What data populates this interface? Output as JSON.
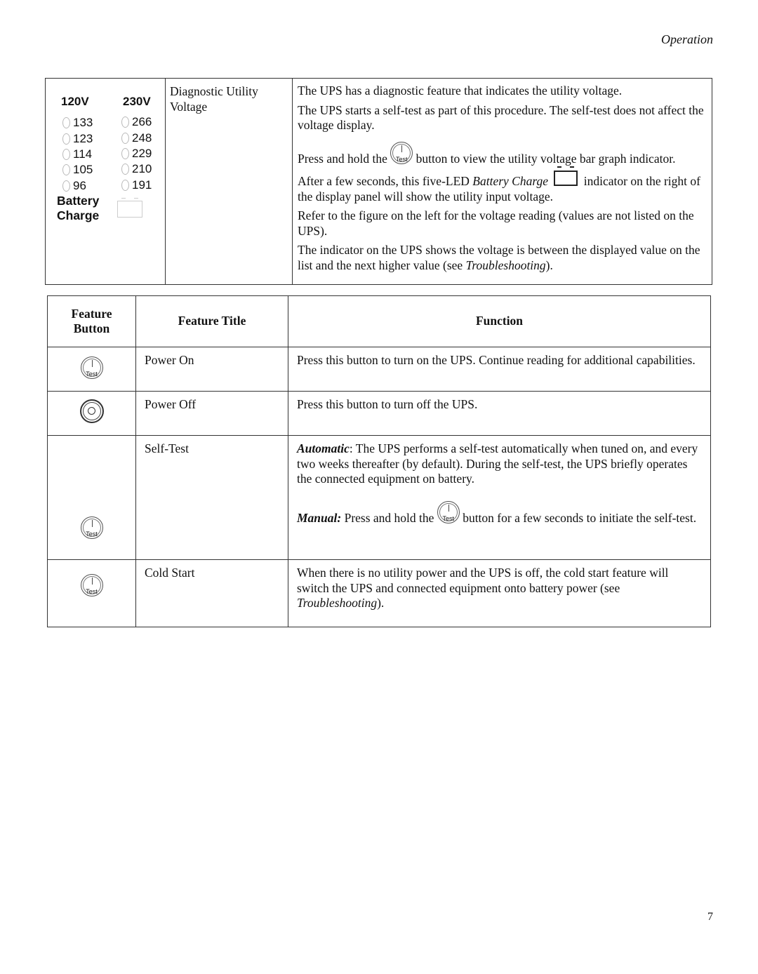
{
  "header": {
    "section": "Operation"
  },
  "page_number": "7",
  "diagnostic_table": {
    "figure": {
      "col_120_label": "120V",
      "col_230_label": "230V",
      "values_120": [
        "133",
        "123",
        "114",
        "105",
        "96"
      ],
      "values_230": [
        "266",
        "248",
        "229",
        "210",
        "191"
      ],
      "battery_label_line1": "Battery",
      "battery_label_line2": "Charge"
    },
    "title": "Diagnostic Utility Voltage",
    "paragraphs": {
      "p1": "The UPS has a diagnostic feature that indicates the utility voltage.",
      "p2": "The UPS starts a self-test as part of this procedure. The self-test does not affect the voltage display.",
      "p3_before": "Press and hold the",
      "p3_after": "button to view the utility voltage bar graph indicator.",
      "p4_before": "After a few seconds, this five-LED",
      "p4_italic": "Battery Charge",
      "p4_after": "indicator on the right of the display panel will show the utility input voltage.",
      "p5": "Refer to the figure on the left for the voltage reading (values are not listed on the UPS).",
      "p6_before": "The indicator on the UPS shows the voltage is between the displayed value on the list and the next higher value (see",
      "p6_italic": "Troubleshooting",
      "p6_after": ")."
    },
    "test_icon_label": "Test"
  },
  "feature_table": {
    "headers": {
      "button": "Feature Button",
      "title": "Feature Title",
      "function": "Function"
    },
    "rows": [
      {
        "icon": "test-button-icon",
        "title": "Power On",
        "function": "Press this button to turn on the UPS. Continue reading for additional capabilities."
      },
      {
        "icon": "power-off-button-icon",
        "title": "Power Off",
        "function": "Press this button to turn off the UPS."
      },
      {
        "icon": "test-button-icon",
        "title": "Self-Test",
        "auto_label": "Automatic",
        "auto_text": ": The UPS performs a self-test automatically when tuned on, and every two weeks thereafter (by default). During the self-test, the UPS briefly operates the connected equipment on battery.",
        "manual_label": "Manual:",
        "manual_before": " Press and hold the",
        "manual_after": "button for a few seconds to initiate the self-test."
      },
      {
        "icon": "test-button-icon",
        "title": "Cold Start",
        "function_before": "When there is no utility power and the UPS is off, the cold start feature will switch the UPS and connected equipment onto battery power (see",
        "function_italic": "Troubleshooting",
        "function_after": ")."
      }
    ]
  }
}
